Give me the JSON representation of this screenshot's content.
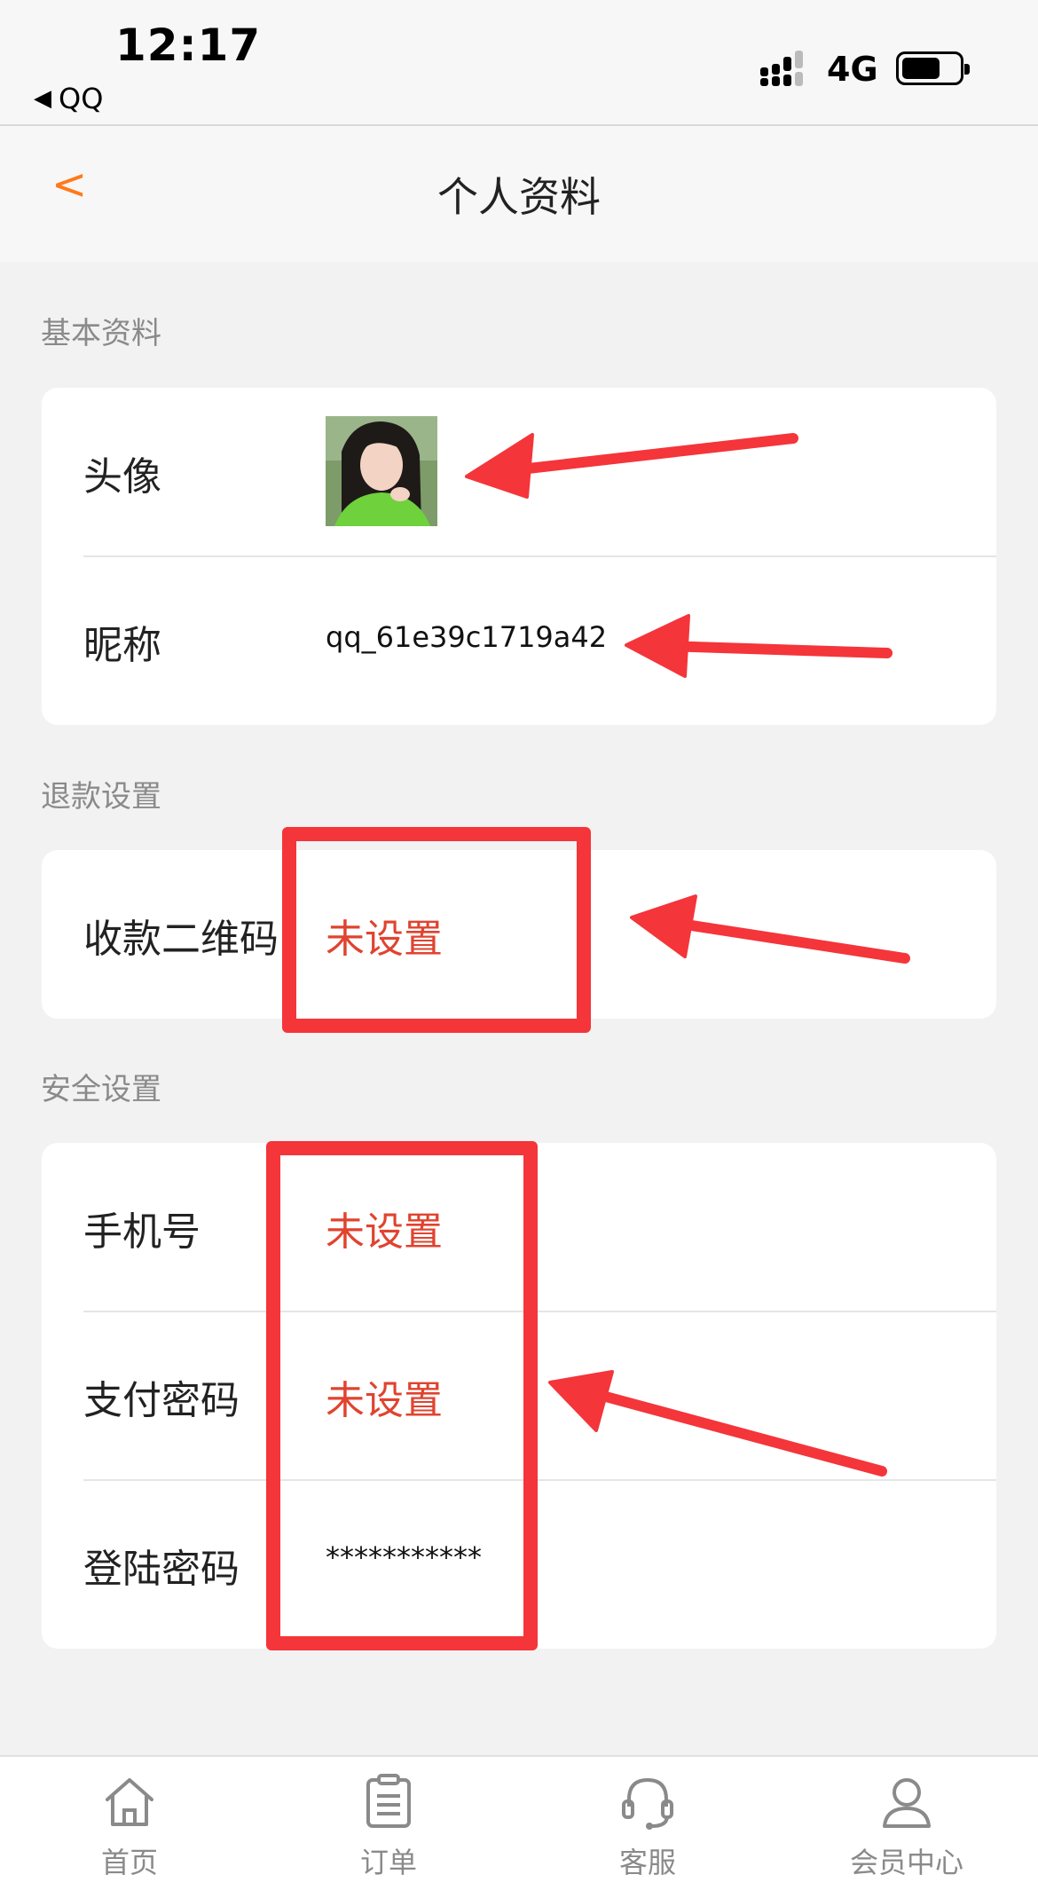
{
  "status_bar": {
    "time": "12:17",
    "back_app": "QQ",
    "network": "4G"
  },
  "nav": {
    "back_label": "<",
    "title": "个人资料"
  },
  "sections": {
    "basic": {
      "title": "基本资料",
      "avatar_label": "头像",
      "nickname_label": "昵称",
      "nickname_value": "qq_61e39c1719a42"
    },
    "refund": {
      "title": "退款设置",
      "qrcode_label": "收款二维码",
      "qrcode_value": "未设置"
    },
    "security": {
      "title": "安全设置",
      "phone_label": "手机号",
      "phone_value": "未设置",
      "pay_password_label": "支付密码",
      "pay_password_value": "未设置",
      "login_password_label": "登陆密码",
      "login_password_value": "***********"
    }
  },
  "tabbar": {
    "items": [
      {
        "label": "首页",
        "icon": "home-icon"
      },
      {
        "label": "订单",
        "icon": "clipboard-icon"
      },
      {
        "label": "客服",
        "icon": "headset-icon"
      },
      {
        "label": "会员中心",
        "icon": "person-icon"
      }
    ]
  },
  "colors": {
    "accent": "#ff7a1a",
    "warn_text": "#e0432f",
    "annotation": "#f4353a",
    "background": "#f2f2f2"
  }
}
